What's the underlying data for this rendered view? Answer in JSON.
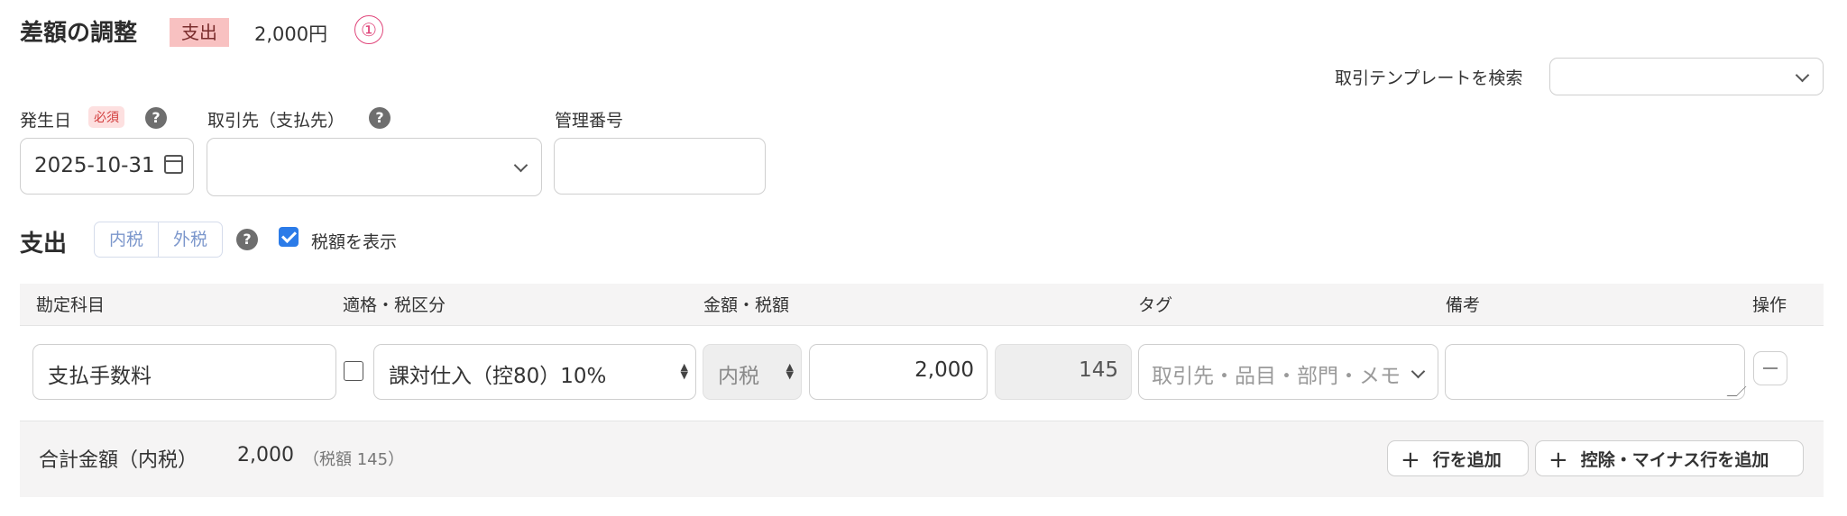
{
  "header": {
    "title": "差額の調整",
    "type_badge": "支出",
    "amount": "2,000円",
    "marker": "①"
  },
  "template_search": {
    "label": "取引テンプレートを検索",
    "value": ""
  },
  "fields": {
    "issue_date": {
      "label": "発生日",
      "required_badge": "必須",
      "value": "2025-10-31"
    },
    "partner": {
      "label": "取引先（支払先）",
      "value": ""
    },
    "ref_number": {
      "label": "管理番号",
      "value": ""
    }
  },
  "expense_section": {
    "title": "支出",
    "tax_modes": [
      "内税",
      "外税"
    ],
    "show_tax_label": "税額を表示",
    "show_tax_checked": true
  },
  "table": {
    "headers": [
      "勘定科目",
      "適格・税区分",
      "金額・税額",
      "タグ",
      "備考",
      "操作"
    ],
    "rows": [
      {
        "account": "支払手数料",
        "qualified_checked": false,
        "tax_category": "課対仕入（控80）10%",
        "tax_mode": "内税",
        "amount": "2,000",
        "tax_amount": "145",
        "tags_placeholder": "取引先・品目・部門・メモ",
        "memo": ""
      }
    ]
  },
  "footer": {
    "total_label": "合計金額（内税）",
    "total_value": "2,000",
    "tax_note": "（税額 145）",
    "add_row_label": "行を追加",
    "add_deduction_label": "控除・マイナス行を追加"
  },
  "colors": {
    "badge_bg": "#f8c1c1",
    "marker": "#e0457a",
    "checkbox": "#2b7be8",
    "segment_text": "#7c97cc"
  }
}
